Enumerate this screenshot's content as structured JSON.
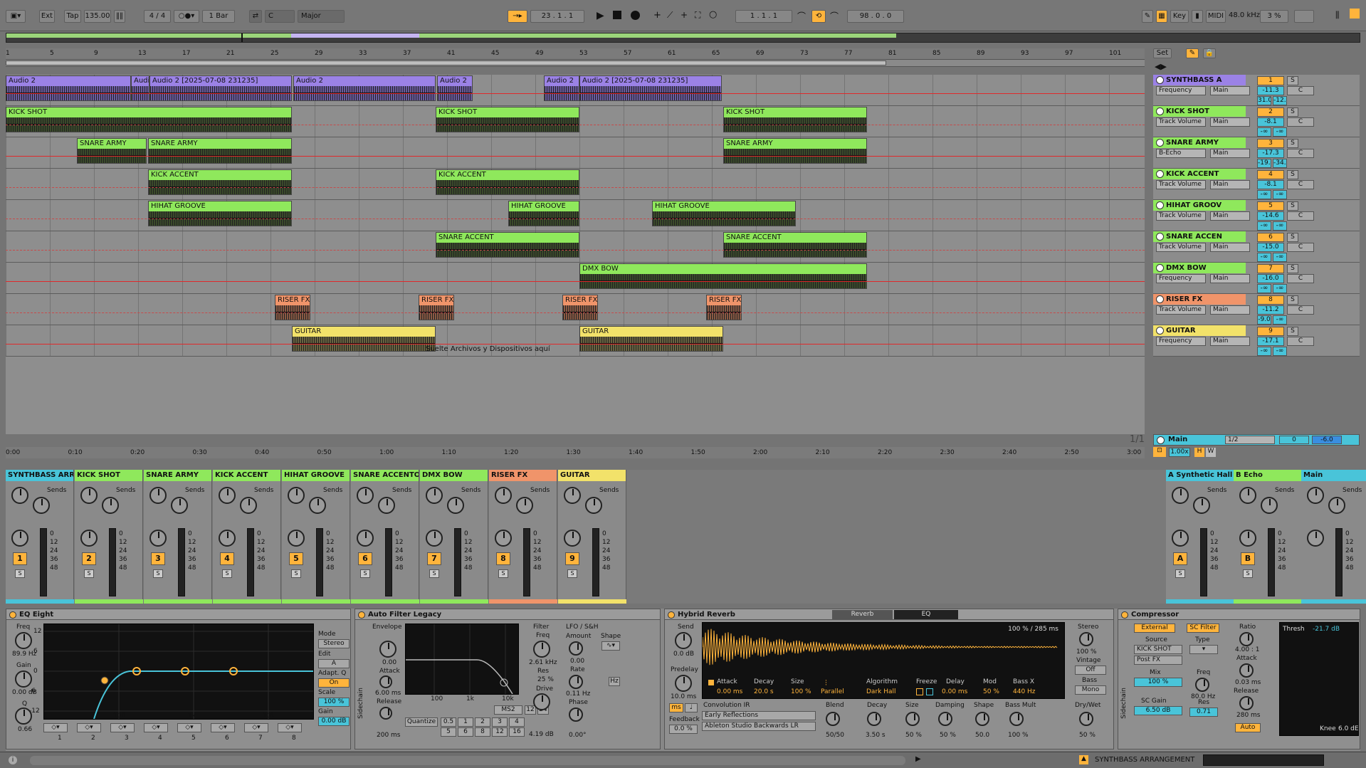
{
  "transport": {
    "ext": "Ext",
    "tap": "Tap",
    "tempo": "135.00",
    "signature": "4 / 4",
    "quant": "1 Bar",
    "key": "C",
    "scale": "Major",
    "position": "23 .  1 .  1",
    "loop_start": "1 .  1 .  1",
    "loop_len": "98 .  0 .  0",
    "key_btn": "Key",
    "midi_btn": "MIDI",
    "sample_rate": "48.0 kHz",
    "cpu": "3 %"
  },
  "ruler": {
    "bars": [
      "1",
      "5",
      "9",
      "13",
      "17",
      "21",
      "25",
      "29",
      "33",
      "37",
      "41",
      "45",
      "49",
      "53",
      "57",
      "61",
      "65",
      "69",
      "73",
      "77",
      "81",
      "85",
      "89",
      "93",
      "97",
      "101"
    ],
    "set_btn": "Set"
  },
  "time_ruler": [
    "0:00",
    "0:10",
    "0:20",
    "0:30",
    "0:40",
    "0:50",
    "1:00",
    "1:10",
    "1:20",
    "1:30",
    "1:40",
    "1:50",
    "2:00",
    "2:10",
    "2:20",
    "2:30",
    "2:40",
    "2:50",
    "3:00"
  ],
  "drop_hint": "Suelte Archivos y Dispositivos aquí",
  "page_indicator": "1/1",
  "tracks": [
    {
      "name": "SYNTHBASS A",
      "color": "#9b82e6",
      "device": "Frequency",
      "out": "Main",
      "num": "1",
      "vol": "-11.3",
      "pan": "C",
      "a": "31.0",
      "b": "-12.8",
      "clips": [
        {
          "label": "Audio 2",
          "start": 0,
          "len": 176
        },
        {
          "label": "Audio",
          "start": 176,
          "len": 26
        },
        {
          "label": "Audio 2 [2025-07-08 231235]",
          "start": 202,
          "len": 200
        },
        {
          "label": "Audio 2",
          "start": 404,
          "len": 200
        },
        {
          "label": "Audio 2",
          "start": 606,
          "len": 50
        },
        {
          "label": "Audio 2",
          "start": 756,
          "len": 50
        },
        {
          "label": "Audio 2 [2025-07-08 231235]",
          "start": 806,
          "len": 200
        }
      ]
    },
    {
      "name": "KICK SHOT",
      "color": "#8fe85c",
      "device": "Track Volume",
      "out": "Main",
      "num": "2",
      "vol": "-8.1",
      "pan": "C",
      "a": "-∞",
      "b": "-∞",
      "clips": [
        {
          "label": "KICK SHOT",
          "start": 0,
          "len": 402
        },
        {
          "label": "KICK SHOT",
          "start": 604,
          "len": 202
        },
        {
          "label": "KICK SHOT",
          "start": 1008,
          "len": 202
        }
      ]
    },
    {
      "name": "SNARE ARMY",
      "color": "#8fe85c",
      "device": "B-Echo",
      "out": "Main",
      "num": "3",
      "vol": "-17.3",
      "pan": "C",
      "a": "-19.4",
      "b": "-34.0",
      "clips": [
        {
          "label": "SNARE ARMY",
          "start": 100,
          "len": 98
        },
        {
          "label": "SNARE ARMY",
          "start": 200,
          "len": 202
        },
        {
          "label": "SNARE ARMY",
          "start": 1008,
          "len": 202
        }
      ]
    },
    {
      "name": "KICK ACCENT",
      "color": "#8fe85c",
      "device": "Track Volume",
      "out": "Main",
      "num": "4",
      "vol": "-8.1",
      "pan": "C",
      "a": "-∞",
      "b": "-∞",
      "clips": [
        {
          "label": "KICK ACCENT",
          "start": 200,
          "len": 202
        },
        {
          "label": "KICK ACCENT",
          "start": 604,
          "len": 202
        }
      ]
    },
    {
      "name": "HIHAT GROOV",
      "color": "#8fe85c",
      "device": "Track Volume",
      "out": "Main",
      "num": "5",
      "vol": "-14.6",
      "pan": "C",
      "a": "-∞",
      "b": "-∞",
      "clips": [
        {
          "label": "HIHAT GROOVE",
          "start": 200,
          "len": 202
        },
        {
          "label": "HIHAT GROOVE",
          "start": 706,
          "len": 100
        },
        {
          "label": "HIHAT GROOVE",
          "start": 908,
          "len": 202
        }
      ]
    },
    {
      "name": "SNARE ACCEN",
      "color": "#8fe85c",
      "device": "Track Volume",
      "out": "Main",
      "num": "6",
      "vol": "-15.0",
      "pan": "C",
      "a": "-∞",
      "b": "-∞",
      "clips": [
        {
          "label": "SNARE ACCENT",
          "start": 604,
          "len": 202
        },
        {
          "label": "SNARE ACCENT",
          "start": 1008,
          "len": 202
        }
      ]
    },
    {
      "name": "DMX BOW",
      "color": "#8fe85c",
      "device": "Frequency",
      "out": "Main",
      "num": "7",
      "vol": "-16.0",
      "pan": "C",
      "a": "-∞",
      "b": "-∞",
      "clips": [
        {
          "label": "DMX BOW",
          "start": 806,
          "len": 404
        }
      ]
    },
    {
      "name": "RISER FX",
      "color": "#f0946a",
      "device": "Track Volume",
      "out": "Main",
      "num": "8",
      "vol": "-11.2",
      "pan": "C",
      "a": "-9.0",
      "b": "-∞",
      "clips": [
        {
          "label": "RISER FX [20",
          "start": 378,
          "len": 50
        },
        {
          "label": "RISER FX [20",
          "start": 580,
          "len": 50
        },
        {
          "label": "RISER FX [20",
          "start": 782,
          "len": 50
        },
        {
          "label": "RISER FX [20",
          "start": 984,
          "len": 50
        }
      ]
    },
    {
      "name": "GUITAR",
      "color": "#f2e26a",
      "device": "Frequency",
      "out": "Main",
      "num": "9",
      "vol": "-17.1",
      "pan": "C",
      "a": "-∞",
      "b": "-∞",
      "clips": [
        {
          "label": "GUITAR",
          "start": 402,
          "len": 202
        },
        {
          "label": "GUITAR",
          "start": 806,
          "len": 202
        }
      ]
    }
  ],
  "main_track": {
    "name": "Main",
    "routing": "1/2",
    "vol": "0",
    "pan": "-6.0",
    "tempo_mult": "1.00x"
  },
  "mixer": {
    "strips": [
      {
        "name": "SYNTHBASS ARR",
        "color": "#49c4d9",
        "num": "1"
      },
      {
        "name": "KICK SHOT",
        "color": "#8fe85c",
        "num": "2"
      },
      {
        "name": "SNARE ARMY",
        "color": "#8fe85c",
        "num": "3"
      },
      {
        "name": "KICK ACCENT",
        "color": "#8fe85c",
        "num": "4"
      },
      {
        "name": "HIHAT GROOVE",
        "color": "#8fe85c",
        "num": "5"
      },
      {
        "name": "SNARE ACCENTO",
        "color": "#8fe85c",
        "num": "6"
      },
      {
        "name": "DMX BOW",
        "color": "#8fe85c",
        "num": "7"
      },
      {
        "name": "RISER FX",
        "color": "#f0946a",
        "num": "8"
      },
      {
        "name": "GUITAR",
        "color": "#f2e26a",
        "num": "9"
      }
    ],
    "returns": [
      {
        "name": "A Synthetic Hall",
        "color": "#49c4d9",
        "num": "A"
      },
      {
        "name": "B Echo",
        "color": "#8fe85c",
        "num": "B"
      },
      {
        "name": "Main",
        "color": "#49c4d9",
        "num": ""
      }
    ],
    "sends_label": "Sends",
    "scale": [
      "0",
      "12",
      "24",
      "36",
      "48"
    ],
    "solo_label": "Solo",
    "post_label": "Post"
  },
  "devices": {
    "eq": {
      "title": "EQ Eight",
      "freq_label": "Freq",
      "freq": "89.9 Hz",
      "gain_label": "Gain",
      "gain": "0.00 dB",
      "q_label": "Q",
      "q": "0.66",
      "mode_label": "Mode",
      "mode": "Stereo",
      "edit_label": "Edit",
      "edit": "A",
      "adapt_label": "Adapt. Q",
      "adapt": "On",
      "scale_label": "Scale",
      "scale": "100 %",
      "gain2_label": "Gain",
      "gain2": "0.00 dB",
      "y_ticks": [
        "12",
        "6",
        "0",
        "-6",
        "-12"
      ],
      "x_ticks": [
        "100",
        "1k",
        "10k"
      ],
      "bands": [
        "1",
        "2",
        "3",
        "4",
        "5",
        "6",
        "7",
        "8"
      ]
    },
    "filter": {
      "title": "Auto Filter Legacy",
      "envelope": "Envelope",
      "env_val": "0.00",
      "attack_label": "Attack",
      "attack": "6.00 ms",
      "release_label": "Release",
      "release": "200 ms",
      "filter_label": "Filter",
      "freq_label": "Freq",
      "freq": "2.61 kHz",
      "res_label": "Res",
      "res": "25 %",
      "drive_label": "Drive",
      "drive": "4.19 dB",
      "lfo_label": "LFO / S&H",
      "amount_label": "Amount",
      "amount": "0.00",
      "rate_label": "Rate",
      "rate": "0.11 Hz",
      "phase_label": "Phase",
      "phase": "0.00°",
      "shape_label": "Shape",
      "hz": "Hz",
      "quantize": "Quantize",
      "qvals": [
        "0.5",
        "1",
        "2",
        "3",
        "4",
        "5",
        "6",
        "8",
        "12",
        "16"
      ],
      "ms2": "MS2",
      "n12": "12",
      "n24": "24",
      "x_ticks": [
        "100",
        "1k",
        "10k"
      ],
      "sidechain": "Sidechain"
    },
    "reverb": {
      "title": "Hybrid Reverb",
      "tab1": "Reverb",
      "tab2": "EQ",
      "send_label": "Send",
      "send": "0.0 dB",
      "predelay_label": "Predelay",
      "predelay": "10.0 ms",
      "ms": "ms",
      "feedback_label": "Feedback",
      "feedback": "0.0 %",
      "info": "100 % / 285 ms",
      "attack_label": "Attack",
      "attack": "0.00 ms",
      "decay_label": "Decay",
      "decay": "20.0 s",
      "size_label": "Size",
      "size": "100 %",
      "routing": "Parallel",
      "algorithm_label": "Algorithm",
      "algorithm": "Dark Hall",
      "freeze_label": "Freeze",
      "delay_label": "Delay",
      "delay": "0.00 ms",
      "mod_label": "Mod",
      "mod": "50 %",
      "bassx_label": "Bass X",
      "bassx": "440 Hz",
      "conv_label": "Convolution IR",
      "conv1": "Early Reflections",
      "conv2": "Ableton Studio Backwards LR",
      "blend_label": "Blend",
      "blend": "50/50",
      "decay2_label": "Decay",
      "decay2": "3.50 s",
      "size2_label": "Size",
      "size2": "50 %",
      "damping_label": "Damping",
      "damping": "50 %",
      "shape_label": "Shape",
      "shape": "50.0",
      "bassmult_label": "Bass Mult",
      "bassmult": "100 %",
      "stereo_label": "Stereo",
      "stereo": "100 %",
      "vintage_label": "Vintage",
      "vintage": "Off",
      "bass_label": "Bass",
      "bass": "Mono",
      "drywet_label": "Dry/Wet",
      "drywet": "50 %"
    },
    "comp": {
      "title": "Compressor",
      "external": "External",
      "scfilter": "SC Filter",
      "source_label": "Source",
      "source": "KICK SHOT",
      "postfx": "Post FX",
      "mix_label": "Mix",
      "mix": "100 %",
      "scgain_label": "SC Gain",
      "scgain": "6.50 dB",
      "type_label": "Type",
      "freq_label": "Freq",
      "freq": "80.0 Hz",
      "res_label": "Res",
      "res": "0.71",
      "ratio_label": "Ratio",
      "ratio": "4.00 : 1",
      "attack_label": "Attack",
      "attack": "0.03 ms",
      "release_label": "Release",
      "release": "280 ms",
      "auto": "Auto",
      "thresh_label": "Thresh",
      "thresh": "-21.7 dB",
      "knee_label": "Knee",
      "knee": "6.0 dE",
      "sidechain": "Sidechain"
    }
  },
  "status": {
    "arrangement": "SYNTHBASS ARRANGEMENT"
  }
}
